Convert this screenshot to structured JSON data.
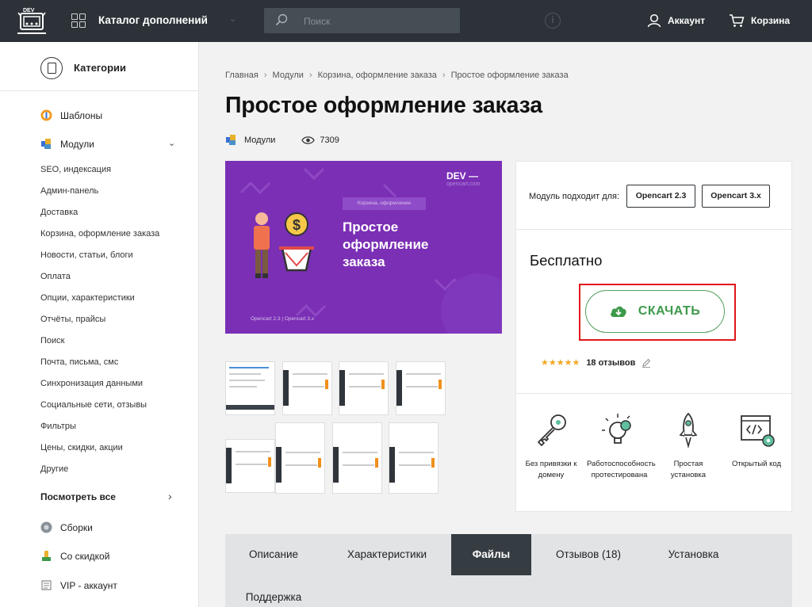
{
  "header": {
    "logo_text": "DEV",
    "catalog_title": "Каталог дополнений",
    "search_placeholder": "Поиск",
    "account_label": "Аккаунт",
    "cart_label": "Корзина",
    "icons": [
      "grid-icon",
      "search-icon",
      "info-icon",
      "user-icon",
      "cart-icon",
      "chevron-down-icon"
    ]
  },
  "sidebar": {
    "title": "Категории",
    "templates": "Шаблоны",
    "modules": "Модули",
    "sub_items": [
      "SEO, индексация",
      "Админ-панель",
      "Доставка",
      "Корзина, оформление заказа",
      "Новости, статьи, блоги",
      "Оплата",
      "Опции, характеристики",
      "Отчёты, прайсы",
      "Поиск",
      "Почта, письма, смс",
      "Синхронизация данными",
      "Социальные сети, отзывы",
      "Фильтры",
      "Цены, скидки, акции",
      "Другие"
    ],
    "view_all": "Посмотреть все",
    "assemblies": "Сборки",
    "discount": "Со скидкой",
    "vip": "VIP - аккаунт"
  },
  "breadcrumb": [
    "Главная",
    "Модули",
    "Корзина, оформление заказа",
    "Простое оформление заказа"
  ],
  "product": {
    "title": "Простое оформление заказа",
    "category": "Модули",
    "views": "7309",
    "banner": {
      "tag": "Корзина, оформление",
      "title_lines": [
        "Простое",
        "оформление",
        "заказа"
      ],
      "dev": "DEV —",
      "sub": "opencart.com",
      "compat": "Opencart 2.3  |  Opencart 3.x"
    }
  },
  "panel": {
    "compat_label": "Модуль подходит для:",
    "compat_versions": [
      "Opencart 2.3",
      "Opencart 3.x"
    ],
    "price": "Бесплатно",
    "download_label": "СКАЧАТЬ",
    "rating_stars": 5,
    "stars_text": "★★★★★",
    "reviews": "18 отзывов",
    "features": [
      {
        "icon": "key-icon",
        "lines": [
          "Без привязки к",
          "домену"
        ]
      },
      {
        "icon": "bulb-gear-icon",
        "lines": [
          "Работоспособность",
          "протестирована"
        ]
      },
      {
        "icon": "rocket-icon",
        "lines": [
          "Простая",
          "установка"
        ]
      },
      {
        "icon": "code-window-icon",
        "lines": [
          "Открытый код"
        ]
      }
    ]
  },
  "tabs": [
    "Описание",
    "Характеристики",
    "Файлы",
    "Отзывов (18)",
    "Установка",
    "Поддержка"
  ],
  "active_tab": "Файлы",
  "colors": {
    "header_bg": "#2c3237",
    "banner_bg": "#7b2fb5",
    "download_green": "#3e9a4b",
    "highlight_red": "#e2161b",
    "stars": "#f0a823",
    "active_tab_bg": "#353c42"
  }
}
